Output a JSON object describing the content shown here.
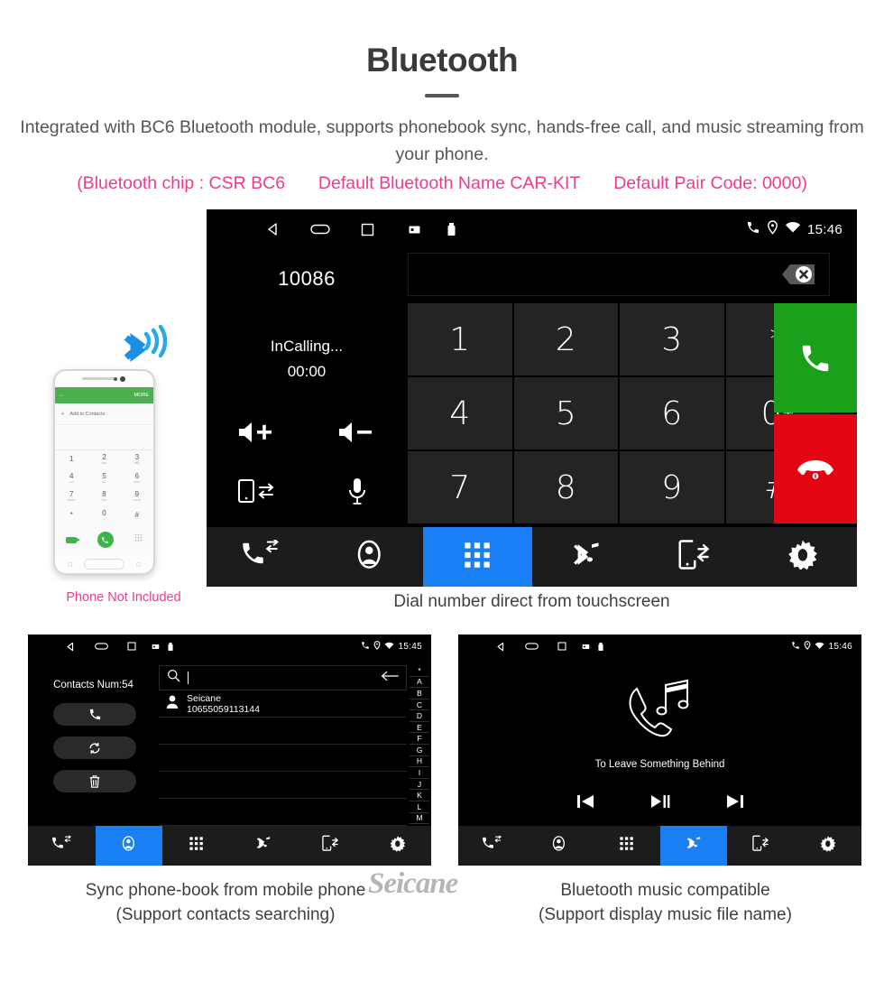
{
  "header": {
    "title": "Bluetooth",
    "subtitle": "Integrated with BC6 Bluetooth module, supports phonebook sync, hands-free call, and music streaming from your phone.",
    "spec_chip": "(Bluetooth chip : CSR BC6",
    "spec_name": "Default Bluetooth Name CAR-KIT",
    "spec_pair": "Default Pair Code: 0000)",
    "accent_color": "#ef3a8e",
    "text_color": "#555555"
  },
  "phone_mockup": {
    "note": "Phone Not Included",
    "appbar_more": "MORE",
    "add_contacts": "Add to Contacts",
    "keys": [
      {
        "digit": "1",
        "letters": ""
      },
      {
        "digit": "2",
        "letters": "ABC"
      },
      {
        "digit": "3",
        "letters": "DEF"
      },
      {
        "digit": "4",
        "letters": "GHI"
      },
      {
        "digit": "5",
        "letters": "JKL"
      },
      {
        "digit": "6",
        "letters": "MNO"
      },
      {
        "digit": "7",
        "letters": "PQRS"
      },
      {
        "digit": "8",
        "letters": "TUV"
      },
      {
        "digit": "9",
        "letters": "WXYZ"
      },
      {
        "digit": "*",
        "letters": ""
      },
      {
        "digit": "0",
        "letters": "+"
      },
      {
        "digit": "#",
        "letters": ""
      }
    ]
  },
  "main_screen": {
    "status_bar": {
      "time": "15:46",
      "icons": [
        "back-icon",
        "home-icon",
        "recents-icon",
        "sd-card-icon",
        "usb-icon"
      ],
      "right_icons": [
        "phone-icon",
        "location-icon",
        "wifi-icon"
      ]
    },
    "call_panel": {
      "number": "10086",
      "status": "InCalling...",
      "timer": "00:00",
      "actions": [
        "volume-up-icon",
        "volume-down-icon",
        "switch-to-phone-icon",
        "microphone-icon"
      ]
    },
    "dial_input": {
      "value": "",
      "backspace_label": "backspace-icon"
    },
    "keypad": [
      "1",
      "2",
      "3",
      "*",
      "4",
      "5",
      "6",
      "0",
      "7",
      "8",
      "9",
      "#"
    ],
    "zero_plus": "+",
    "call_button": "call-icon",
    "hangup_button": "hangup-icon",
    "nav": [
      {
        "name": "call-history",
        "icon": "call-history-icon",
        "active": false
      },
      {
        "name": "contacts",
        "icon": "contact-icon",
        "active": false
      },
      {
        "name": "keypad",
        "icon": "keypad-grid-icon",
        "active": true
      },
      {
        "name": "bluetooth-music",
        "icon": "bluetooth-music-icon",
        "active": false
      },
      {
        "name": "phone-sync",
        "icon": "phone-sync-icon",
        "active": false
      },
      {
        "name": "settings",
        "icon": "gear-icon",
        "active": false
      }
    ],
    "caption": "Dial number direct from touchscreen"
  },
  "contacts_screen": {
    "status_bar": {
      "time": "15:45"
    },
    "contacts_count_label": "Contacts Num:54",
    "side_buttons": [
      "call-icon",
      "sync-icon",
      "delete-icon"
    ],
    "search_placeholder": "",
    "search_value": "",
    "rows": [
      {
        "name": "Seicane",
        "phone": "10655059113144"
      }
    ],
    "alphabet_index": [
      "*",
      "A",
      "B",
      "C",
      "D",
      "E",
      "F",
      "G",
      "H",
      "I",
      "J",
      "K",
      "L",
      "M"
    ],
    "nav": [
      {
        "name": "call-history",
        "icon": "call-history-icon",
        "active": false
      },
      {
        "name": "contacts",
        "icon": "contact-icon",
        "active": true
      },
      {
        "name": "keypad",
        "icon": "keypad-grid-icon",
        "active": false
      },
      {
        "name": "bluetooth-music",
        "icon": "bluetooth-music-icon",
        "active": false
      },
      {
        "name": "phone-sync",
        "icon": "phone-sync-icon",
        "active": false
      },
      {
        "name": "settings",
        "icon": "gear-icon",
        "active": false
      }
    ],
    "caption_line1": "Sync phone-book from mobile phone",
    "caption_line2": "(Support contacts searching)"
  },
  "music_screen": {
    "status_bar": {
      "time": "15:46"
    },
    "track_name": "To Leave Something Behind",
    "controls": [
      "previous-icon",
      "play-pause-icon",
      "next-icon"
    ],
    "nav": [
      {
        "name": "call-history",
        "icon": "call-history-icon",
        "active": false
      },
      {
        "name": "contacts",
        "icon": "contact-icon",
        "active": false
      },
      {
        "name": "keypad",
        "icon": "keypad-grid-icon",
        "active": false
      },
      {
        "name": "bluetooth-music",
        "icon": "bluetooth-music-icon",
        "active": true
      },
      {
        "name": "phone-sync",
        "icon": "phone-sync-icon",
        "active": false
      },
      {
        "name": "settings",
        "icon": "gear-icon",
        "active": false
      }
    ],
    "caption_line1": "Bluetooth music compatible",
    "caption_line2": "(Support display music file name)"
  },
  "watermark": "Seicane"
}
